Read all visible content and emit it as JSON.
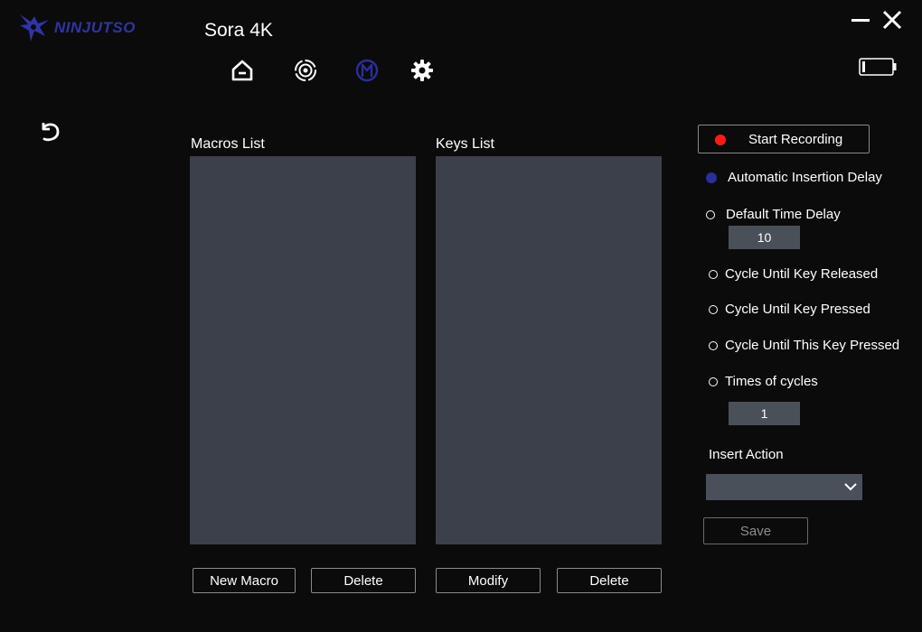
{
  "brand": {
    "name": "NINJUTSO",
    "color": "#2f34a8"
  },
  "device": {
    "title": "Sora 4K"
  },
  "nav": [
    {
      "name": "home-icon",
      "active": false
    },
    {
      "name": "dpi-icon",
      "active": false
    },
    {
      "name": "macro-icon",
      "active": true
    },
    {
      "name": "settings-icon",
      "active": false
    }
  ],
  "colors": {
    "background": "#0b0b0b",
    "panel": "#3b404a",
    "input": "#4a505a",
    "accent": "#2a2f9a",
    "record": "#ff1a1a"
  },
  "macros": {
    "label": "Macros List",
    "items": [],
    "new_label": "New Macro",
    "delete_label": "Delete"
  },
  "keys": {
    "label": "Keys List",
    "items": [],
    "modify_label": "Modify",
    "delete_label": "Delete"
  },
  "recording": {
    "label": "Start Recording"
  },
  "options": {
    "automatic_insertion_delay": "Automatic Insertion Delay",
    "default_time_delay": "Default Time Delay",
    "default_time_delay_value": "10",
    "cycle_until_key_released": "Cycle Until Key Released",
    "cycle_until_key_pressed": "Cycle Until Key Pressed",
    "cycle_until_this_key_pressed": "Cycle Until This Key Pressed",
    "times_of_cycles": "Times of cycles",
    "times_of_cycles_value": "1",
    "selected": "automatic_insertion_delay"
  },
  "insert_action": {
    "label": "Insert Action",
    "selected": ""
  },
  "save_label": "Save"
}
